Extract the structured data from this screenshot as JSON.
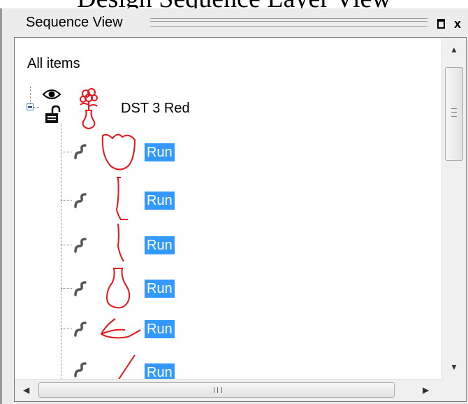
{
  "caption": "Design Sequence Layer View",
  "window": {
    "title": "Sequence View",
    "dock_button": "□",
    "close_button": "x"
  },
  "tree": {
    "root_label": "All items",
    "parent": {
      "label": "DST 3 Red",
      "icons": [
        "eye-icon",
        "lock-open-icon",
        "vase-flower-icon"
      ],
      "expanded": true
    },
    "children": [
      {
        "label": "Run",
        "stitch_type_icon": "stitch-run-icon",
        "preview": "tulip-outline"
      },
      {
        "label": "Run",
        "stitch_type_icon": "stitch-run-icon",
        "preview": "bracket-line"
      },
      {
        "label": "Run",
        "stitch_type_icon": "stitch-run-icon",
        "preview": "vertical-line"
      },
      {
        "label": "Run",
        "stitch_type_icon": "stitch-run-icon",
        "preview": "vase-outline"
      },
      {
        "label": "Run",
        "stitch_type_icon": "stitch-run-icon",
        "preview": "leaf-outline"
      },
      {
        "label": "Run",
        "stitch_type_icon": "stitch-run-icon",
        "preview": "diagonal-line"
      }
    ]
  },
  "colors": {
    "selection": "#3399ff",
    "stitch_red": "#e8141a"
  },
  "scrollbars": {
    "vertical": "visible",
    "horizontal": "visible"
  }
}
